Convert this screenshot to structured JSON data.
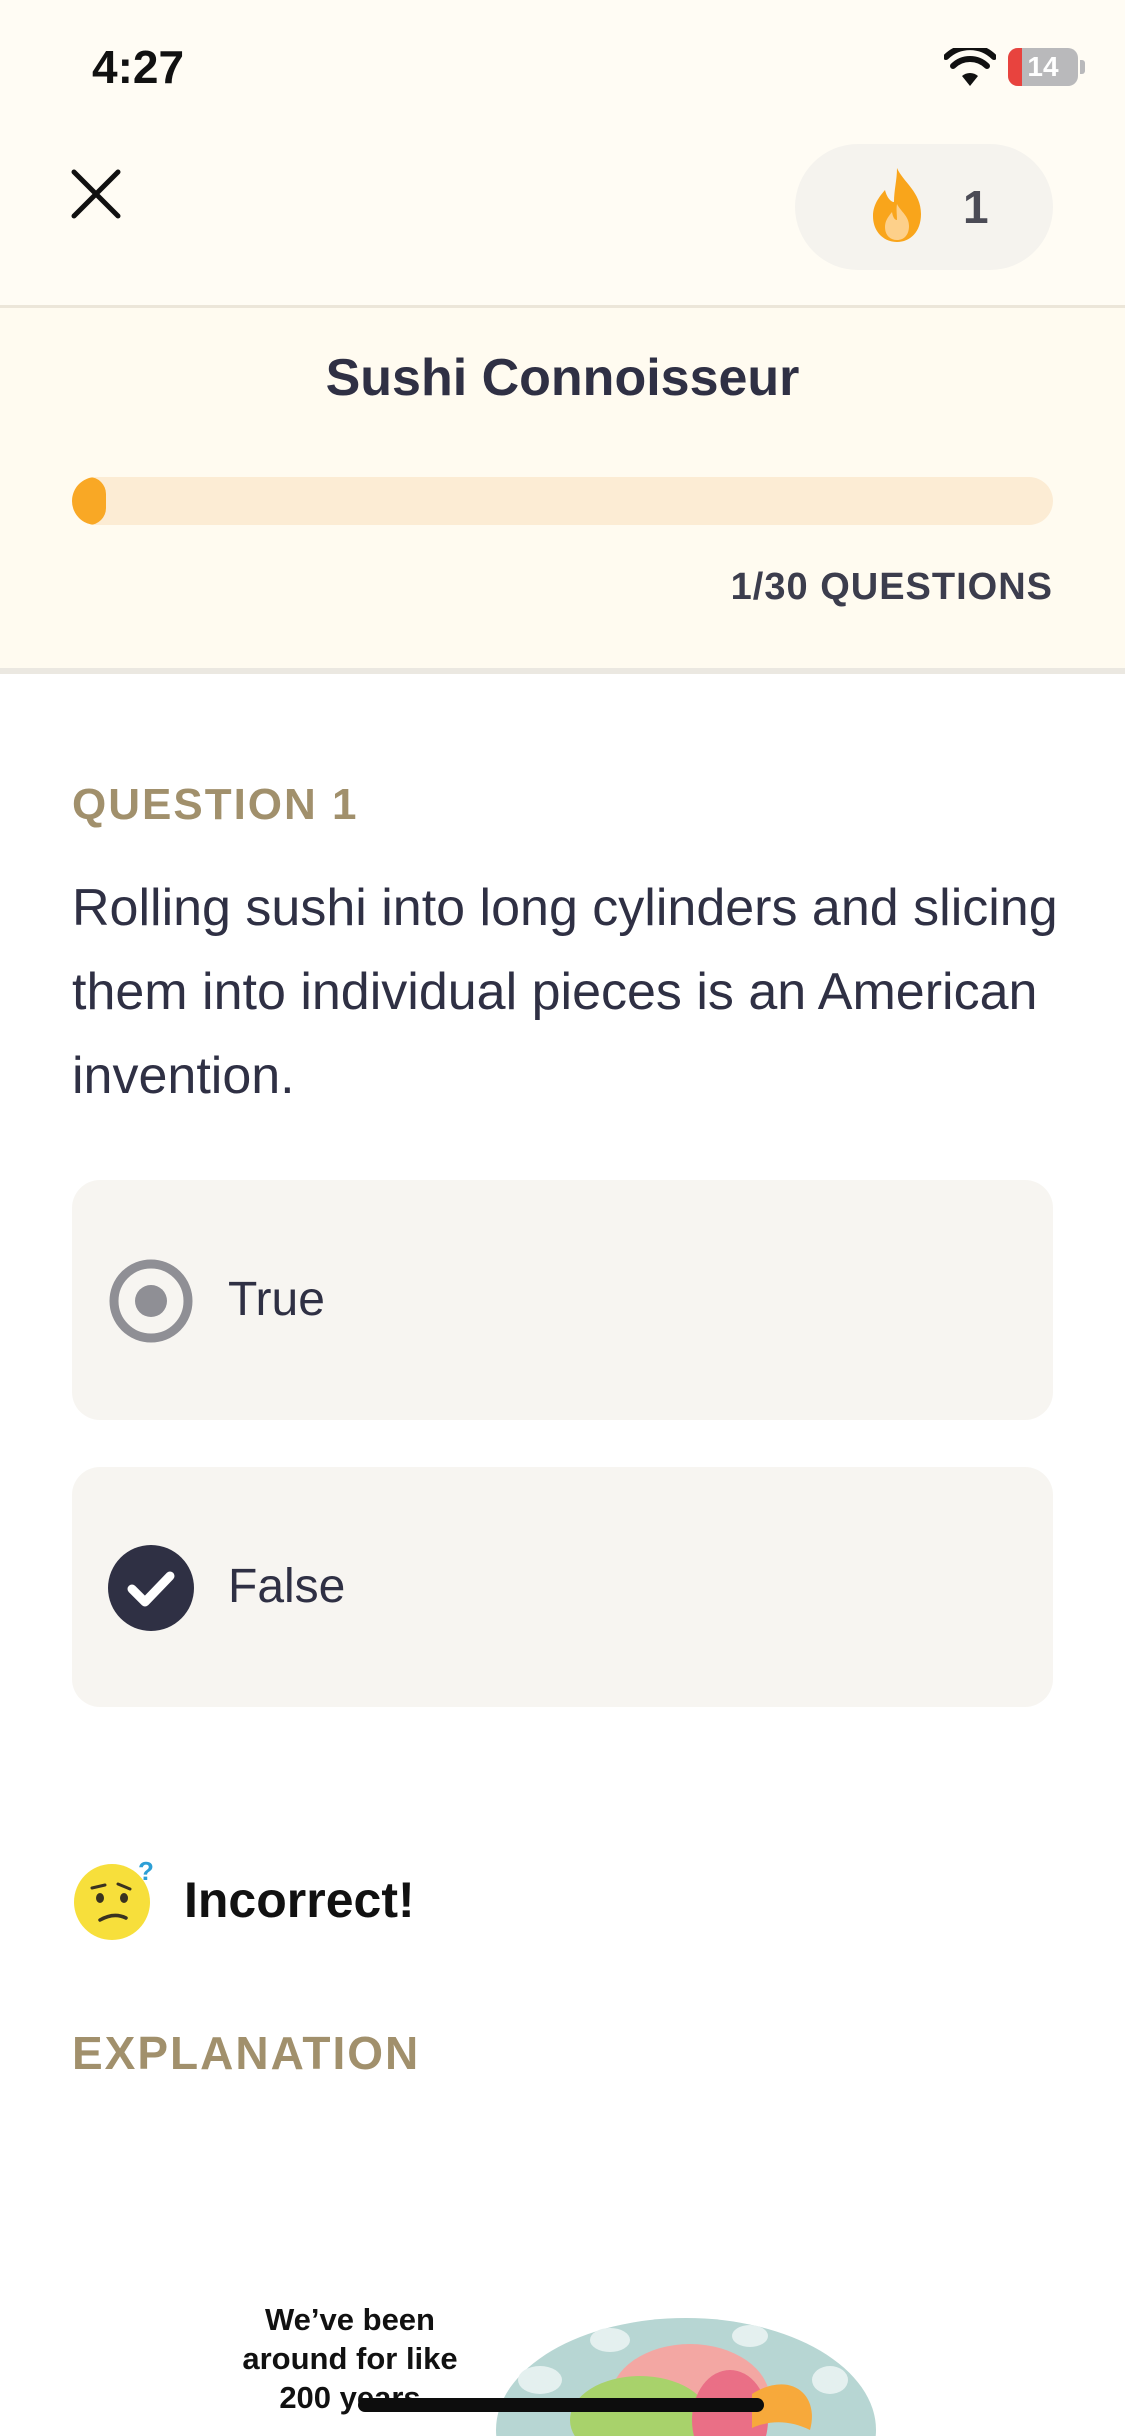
{
  "status_bar": {
    "time": "4:27",
    "battery": "14"
  },
  "header": {
    "streak_count": "1"
  },
  "quiz": {
    "title": "Sushi Connoisseur",
    "progress_fraction": 0.0333,
    "progress_label": "1/30 QUESTIONS"
  },
  "question": {
    "label": "QUESTION 1",
    "text": "Rolling sushi into long cylinders and slicing them into individual pieces is an American invention.",
    "options": [
      {
        "label": "True",
        "state": "selected"
      },
      {
        "label": "False",
        "state": "correct"
      }
    ]
  },
  "result": {
    "text": "Incorrect!"
  },
  "explanation": {
    "label": "EXPLANATION",
    "bubble_lines": [
      "We’ve been",
      "around for like",
      "200 years"
    ]
  },
  "colors": {
    "accent": "#f9a825",
    "muted_gold": "#a1906c",
    "dark": "#2f3044"
  }
}
